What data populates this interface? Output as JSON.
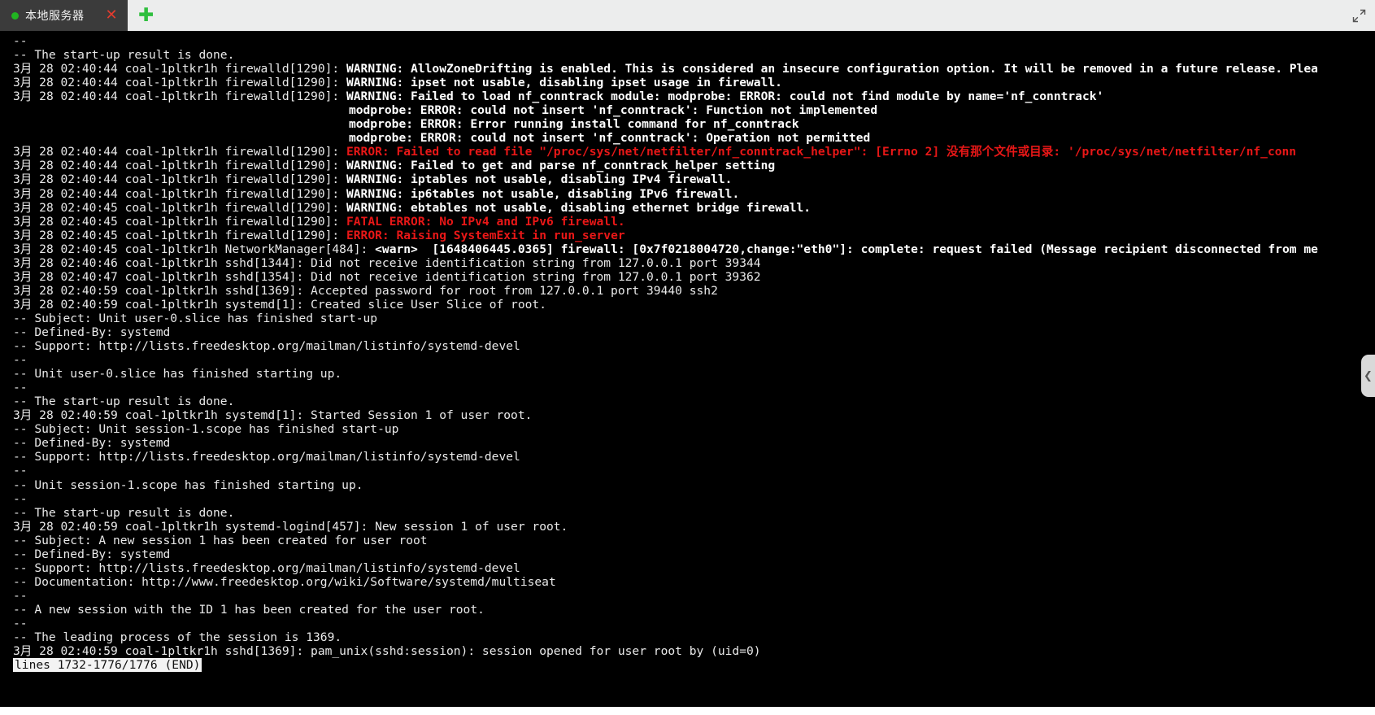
{
  "window": {
    "tab": {
      "label": "本地服务器",
      "status_dot_color": "#21b521",
      "close_label": "✕"
    },
    "new_tab_label": "✚",
    "fullscreen_icon": "expand-arrows-icon"
  },
  "drawer": {
    "handle_icon": "chevron-left-icon",
    "handle_glyph": "❮"
  },
  "terminal": {
    "colors": {
      "background": "#000000",
      "normal_text": "#e9e9e9",
      "bold_text": "#ffffff",
      "error_text": "#e81717",
      "pager_background": "#f3f3f3",
      "pager_text": "#111111"
    },
    "pager_status": "lines 1732-1776/1776 (END)",
    "lines": [
      {
        "segments": [
          {
            "t": "--",
            "c": "white"
          }
        ]
      },
      {
        "segments": [
          {
            "t": "-- The start-up result is done.",
            "c": "white"
          }
        ]
      },
      {
        "segments": [
          {
            "t": "3月 28 02:40:44 coal-1pltkr1h firewalld[1290]: ",
            "c": "white"
          },
          {
            "t": "WARNING: AllowZoneDrifting is enabled. This is considered an insecure configuration option. It will be removed in a future release. Plea",
            "c": "bold"
          }
        ]
      },
      {
        "segments": [
          {
            "t": "3月 28 02:40:44 coal-1pltkr1h firewalld[1290]: ",
            "c": "white"
          },
          {
            "t": "WARNING: ipset not usable, disabling ipset usage in firewall.",
            "c": "bold"
          }
        ]
      },
      {
        "segments": [
          {
            "t": "3月 28 02:40:44 coal-1pltkr1h firewalld[1290]: ",
            "c": "white"
          },
          {
            "t": "WARNING: Failed to load nf_conntrack module: modprobe: ERROR: could not find module by name='nf_conntrack'",
            "c": "bold"
          }
        ]
      },
      {
        "segments": [
          {
            "t": "                                               modprobe: ERROR: could not insert 'nf_conntrack': Function not implemented",
            "c": "bold"
          }
        ]
      },
      {
        "segments": [
          {
            "t": "                                               modprobe: ERROR: Error running install command for nf_conntrack",
            "c": "bold"
          }
        ]
      },
      {
        "segments": [
          {
            "t": "                                               modprobe: ERROR: could not insert 'nf_conntrack': Operation not permitted",
            "c": "bold"
          }
        ]
      },
      {
        "segments": [
          {
            "t": "3月 28 02:40:44 coal-1pltkr1h firewalld[1290]: ",
            "c": "white"
          },
          {
            "t": "ERROR: Failed to read file \"/proc/sys/net/netfilter/nf_conntrack_helper\": [Errno 2] 没有那个文件或目录: '/proc/sys/net/netfilter/nf_conn",
            "c": "red"
          }
        ]
      },
      {
        "segments": [
          {
            "t": "3月 28 02:40:44 coal-1pltkr1h firewalld[1290]: ",
            "c": "white"
          },
          {
            "t": "WARNING: Failed to get and parse nf_conntrack_helper setting",
            "c": "bold"
          }
        ]
      },
      {
        "segments": [
          {
            "t": "3月 28 02:40:44 coal-1pltkr1h firewalld[1290]: ",
            "c": "white"
          },
          {
            "t": "WARNING: iptables not usable, disabling IPv4 firewall.",
            "c": "bold"
          }
        ]
      },
      {
        "segments": [
          {
            "t": "3月 28 02:40:44 coal-1pltkr1h firewalld[1290]: ",
            "c": "white"
          },
          {
            "t": "WARNING: ip6tables not usable, disabling IPv6 firewall.",
            "c": "bold"
          }
        ]
      },
      {
        "segments": [
          {
            "t": "3月 28 02:40:45 coal-1pltkr1h firewalld[1290]: ",
            "c": "white"
          },
          {
            "t": "WARNING: ebtables not usable, disabling ethernet bridge firewall.",
            "c": "bold"
          }
        ]
      },
      {
        "segments": [
          {
            "t": "3月 28 02:40:45 coal-1pltkr1h firewalld[1290]: ",
            "c": "white"
          },
          {
            "t": "FATAL ERROR: No IPv4 and IPv6 firewall.",
            "c": "red"
          }
        ]
      },
      {
        "segments": [
          {
            "t": "3月 28 02:40:45 coal-1pltkr1h firewalld[1290]: ",
            "c": "white"
          },
          {
            "t": "ERROR: Raising SystemExit in run_server",
            "c": "red"
          }
        ]
      },
      {
        "segments": [
          {
            "t": "3月 28 02:40:45 coal-1pltkr1h NetworkManager[484]: ",
            "c": "white"
          },
          {
            "t": "<warn>",
            "c": "bold"
          },
          {
            "t": "  [1648406445.0365] firewall: [0x7f0218004720,change:\"eth0\"]: complete: request failed (Message recipient disconnected from me",
            "c": "bold"
          }
        ]
      },
      {
        "segments": [
          {
            "t": "3月 28 02:40:46 coal-1pltkr1h sshd[1344]: Did not receive identification string from 127.0.0.1 port 39344",
            "c": "white"
          }
        ]
      },
      {
        "segments": [
          {
            "t": "3月 28 02:40:47 coal-1pltkr1h sshd[1354]: Did not receive identification string from 127.0.0.1 port 39362",
            "c": "white"
          }
        ]
      },
      {
        "segments": [
          {
            "t": "3月 28 02:40:59 coal-1pltkr1h sshd[1369]: Accepted password for root from 127.0.0.1 port 39440 ssh2",
            "c": "white"
          }
        ]
      },
      {
        "segments": [
          {
            "t": "3月 28 02:40:59 coal-1pltkr1h systemd[1]: Created slice User Slice of root.",
            "c": "white"
          }
        ]
      },
      {
        "segments": [
          {
            "t": "-- Subject: Unit user-0.slice has finished start-up",
            "c": "white"
          }
        ]
      },
      {
        "segments": [
          {
            "t": "-- Defined-By: systemd",
            "c": "white"
          }
        ]
      },
      {
        "segments": [
          {
            "t": "-- Support: http://lists.freedesktop.org/mailman/listinfo/systemd-devel",
            "c": "white"
          }
        ]
      },
      {
        "segments": [
          {
            "t": "--",
            "c": "white"
          }
        ]
      },
      {
        "segments": [
          {
            "t": "-- Unit user-0.slice has finished starting up.",
            "c": "white"
          }
        ]
      },
      {
        "segments": [
          {
            "t": "--",
            "c": "white"
          }
        ]
      },
      {
        "segments": [
          {
            "t": "-- The start-up result is done.",
            "c": "white"
          }
        ]
      },
      {
        "segments": [
          {
            "t": "3月 28 02:40:59 coal-1pltkr1h systemd[1]: Started Session 1 of user root.",
            "c": "white"
          }
        ]
      },
      {
        "segments": [
          {
            "t": "-- Subject: Unit session-1.scope has finished start-up",
            "c": "white"
          }
        ]
      },
      {
        "segments": [
          {
            "t": "-- Defined-By: systemd",
            "c": "white"
          }
        ]
      },
      {
        "segments": [
          {
            "t": "-- Support: http://lists.freedesktop.org/mailman/listinfo/systemd-devel",
            "c": "white"
          }
        ]
      },
      {
        "segments": [
          {
            "t": "--",
            "c": "white"
          }
        ]
      },
      {
        "segments": [
          {
            "t": "-- Unit session-1.scope has finished starting up.",
            "c": "white"
          }
        ]
      },
      {
        "segments": [
          {
            "t": "--",
            "c": "white"
          }
        ]
      },
      {
        "segments": [
          {
            "t": "-- The start-up result is done.",
            "c": "white"
          }
        ]
      },
      {
        "segments": [
          {
            "t": "3月 28 02:40:59 coal-1pltkr1h systemd-logind[457]: New session 1 of user root.",
            "c": "white"
          }
        ]
      },
      {
        "segments": [
          {
            "t": "-- Subject: A new session 1 has been created for user root",
            "c": "white"
          }
        ]
      },
      {
        "segments": [
          {
            "t": "-- Defined-By: systemd",
            "c": "white"
          }
        ]
      },
      {
        "segments": [
          {
            "t": "-- Support: http://lists.freedesktop.org/mailman/listinfo/systemd-devel",
            "c": "white"
          }
        ]
      },
      {
        "segments": [
          {
            "t": "-- Documentation: http://www.freedesktop.org/wiki/Software/systemd/multiseat",
            "c": "white"
          }
        ]
      },
      {
        "segments": [
          {
            "t": "--",
            "c": "white"
          }
        ]
      },
      {
        "segments": [
          {
            "t": "-- A new session with the ID 1 has been created for the user root.",
            "c": "white"
          }
        ]
      },
      {
        "segments": [
          {
            "t": "--",
            "c": "white"
          }
        ]
      },
      {
        "segments": [
          {
            "t": "-- The leading process of the session is 1369.",
            "c": "white"
          }
        ]
      },
      {
        "segments": [
          {
            "t": "3月 28 02:40:59 coal-1pltkr1h sshd[1369]: pam_unix(sshd:session): session opened for user root by (uid=0)",
            "c": "white"
          }
        ]
      }
    ]
  }
}
